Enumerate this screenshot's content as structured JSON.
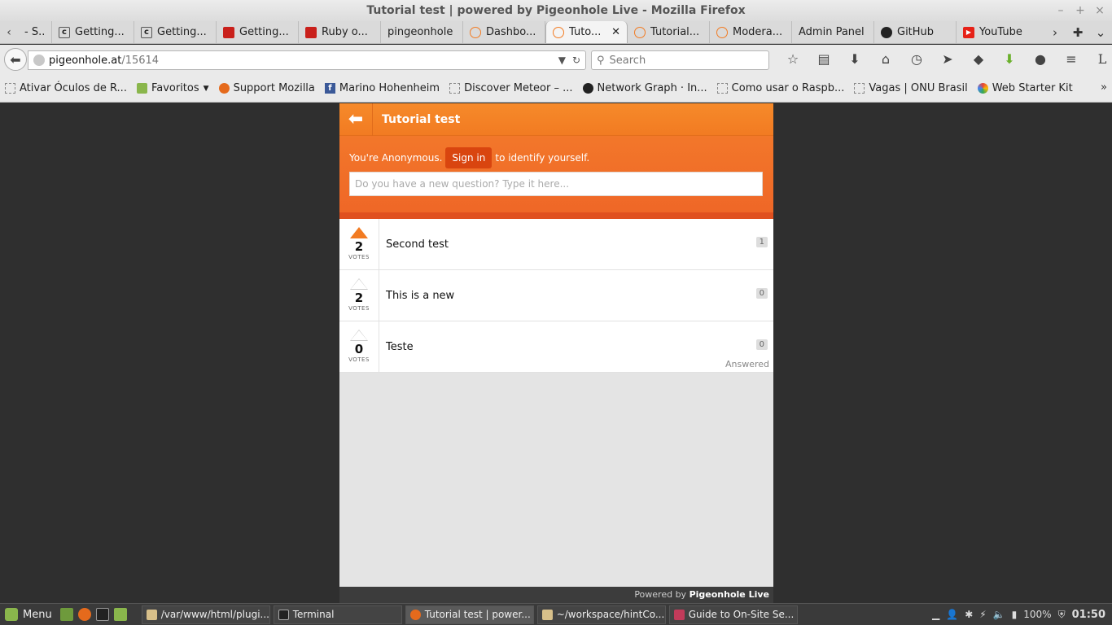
{
  "window": {
    "title": "Tutorial test | powered by Pigeonhole Live - Mozilla Firefox",
    "controls": [
      "–",
      "+",
      "×"
    ]
  },
  "tabs": [
    {
      "label": "- S...",
      "icon": "page-icon"
    },
    {
      "label": "Getting...",
      "icon": "page-icon"
    },
    {
      "label": "Getting...",
      "icon": "page-icon"
    },
    {
      "label": "Getting...",
      "icon": "ruby-icon"
    },
    {
      "label": "Ruby o...",
      "icon": "ruby-icon"
    },
    {
      "label": "pingeonhole",
      "icon": "none"
    },
    {
      "label": "Dashbo...",
      "icon": "pigeonhole-icon"
    },
    {
      "label": "Tuto...",
      "icon": "pigeonhole-icon",
      "active": true
    },
    {
      "label": "Tutorial...",
      "icon": "pigeonhole-icon"
    },
    {
      "label": "Modera...",
      "icon": "pigeonhole-icon"
    },
    {
      "label": "Admin Panel",
      "icon": "none"
    },
    {
      "label": "GitHub",
      "icon": "github-icon"
    },
    {
      "label": "YouTube",
      "icon": "youtube-icon"
    }
  ],
  "nav": {
    "url_host": "pigeonhole.at",
    "url_path": "/15614",
    "search_placeholder": "Search"
  },
  "bookmarks": [
    {
      "label": "Ativar Óculos de R...",
      "icon": "page-icon"
    },
    {
      "label": "Favoritos",
      "icon": "folder-icon",
      "dropdown": true
    },
    {
      "label": "Support Mozilla",
      "icon": "firefox-icon"
    },
    {
      "label": "Marino Hohenheim",
      "icon": "facebook-icon"
    },
    {
      "label": "Discover Meteor – ...",
      "icon": "page-icon"
    },
    {
      "label": "Network Graph · In...",
      "icon": "github-icon"
    },
    {
      "label": "Como usar o Raspb...",
      "icon": "page-icon"
    },
    {
      "label": "Vagas | ONU Brasil",
      "icon": "page-icon"
    },
    {
      "label": "Web Starter Kit",
      "icon": "google-icon"
    }
  ],
  "app": {
    "title": "Tutorial test",
    "anon_prefix": "You're Anonymous.",
    "signin_label": "Sign in",
    "anon_suffix": "to identify yourself.",
    "question_placeholder": "Do you have a new question? Type it here...",
    "votes_label": "VOTES",
    "questions": [
      {
        "text": "Second test",
        "votes": "2",
        "comments": "1",
        "voted": true,
        "answered": ""
      },
      {
        "text": "This is a new",
        "votes": "2",
        "comments": "0",
        "voted": false,
        "answered": ""
      },
      {
        "text": "Teste",
        "votes": "0",
        "comments": "0",
        "voted": false,
        "answered": "Answered"
      }
    ],
    "footer_prefix": "Powered by",
    "footer_brand": "Pigeonhole Live"
  },
  "taskbar": {
    "menu_label": "Menu",
    "tasks": [
      {
        "label": "/var/www/html/plugi...",
        "icon": "folder-icon"
      },
      {
        "label": "Terminal",
        "icon": "terminal-icon"
      },
      {
        "label": "Tutorial test | power...",
        "icon": "firefox-icon",
        "active": true
      },
      {
        "label": "~/workspace/hintCo...",
        "icon": "folder-icon"
      },
      {
        "label": "Guide to On-Site Se...",
        "icon": "document-icon"
      }
    ],
    "battery": "100%",
    "clock": "01:50"
  },
  "colors": {
    "accent": "#f27b22",
    "accent_dark": "#d9450f",
    "footer": "#3c3c3c"
  }
}
